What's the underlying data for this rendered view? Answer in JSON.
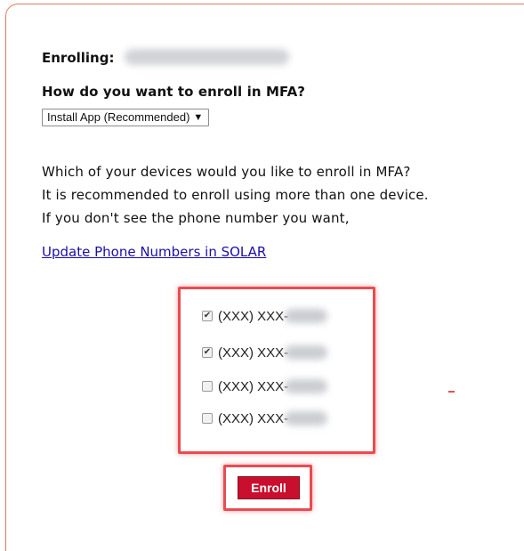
{
  "enrollment": {
    "enrolling_label": "Enrolling:",
    "question": "How do you want to enroll in MFA?",
    "method_selected": "Install App (Recommended)",
    "method_arrow": "▼"
  },
  "info": {
    "line1": "Which of your devices would you like to enroll in MFA?",
    "line2": "It is recommended to enroll using more than one device.",
    "line3": "If you don't see the phone number you want,",
    "link_text": "Update Phone Numbers in SOLAR"
  },
  "devices": [
    {
      "number": "(XXX) XXX-",
      "checked": true,
      "check_glyph": "✔"
    },
    {
      "number": "(XXX) XXX-",
      "checked": true,
      "check_glyph": "✔"
    },
    {
      "number": "(XXX) XXX-",
      "checked": false,
      "check_glyph": ""
    },
    {
      "number": "(XXX) XXX-",
      "checked": false,
      "check_glyph": ""
    }
  ],
  "actions": {
    "enroll_label": "Enroll"
  },
  "colors": {
    "card_border": "#e8795c",
    "highlight": "#e84c52",
    "enroll_button": "#c8102e",
    "link": "#1a0dab"
  }
}
